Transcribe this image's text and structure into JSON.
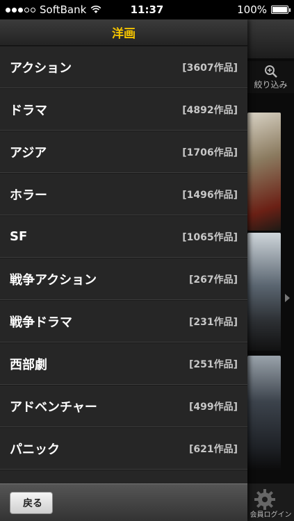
{
  "status_bar": {
    "carrier": "SoftBank",
    "time": "11:37",
    "battery": "100%",
    "battery_level": 1.0
  },
  "background": {
    "filter_label": "絞り込み",
    "login_label": "会員ログイン"
  },
  "drawer": {
    "title": "洋画",
    "genres": [
      {
        "name": "アクション",
        "count": "[3607作品]"
      },
      {
        "name": "ドラマ",
        "count": "[4892作品]"
      },
      {
        "name": "アジア",
        "count": "[1706作品]"
      },
      {
        "name": "ホラー",
        "count": "[1496作品]"
      },
      {
        "name": "SF",
        "count": "[1065作品]"
      },
      {
        "name": "戦争アクション",
        "count": "[267作品]"
      },
      {
        "name": "戦争ドラマ",
        "count": "[231作品]"
      },
      {
        "name": "西部劇",
        "count": "[251作品]"
      },
      {
        "name": "アドベンチャー",
        "count": "[499作品]"
      },
      {
        "name": "パニック",
        "count": "[621作品]"
      }
    ],
    "back_label": "戻る"
  },
  "colors": {
    "title_accent": "#f5c400",
    "drawer_bg": "#262626"
  }
}
